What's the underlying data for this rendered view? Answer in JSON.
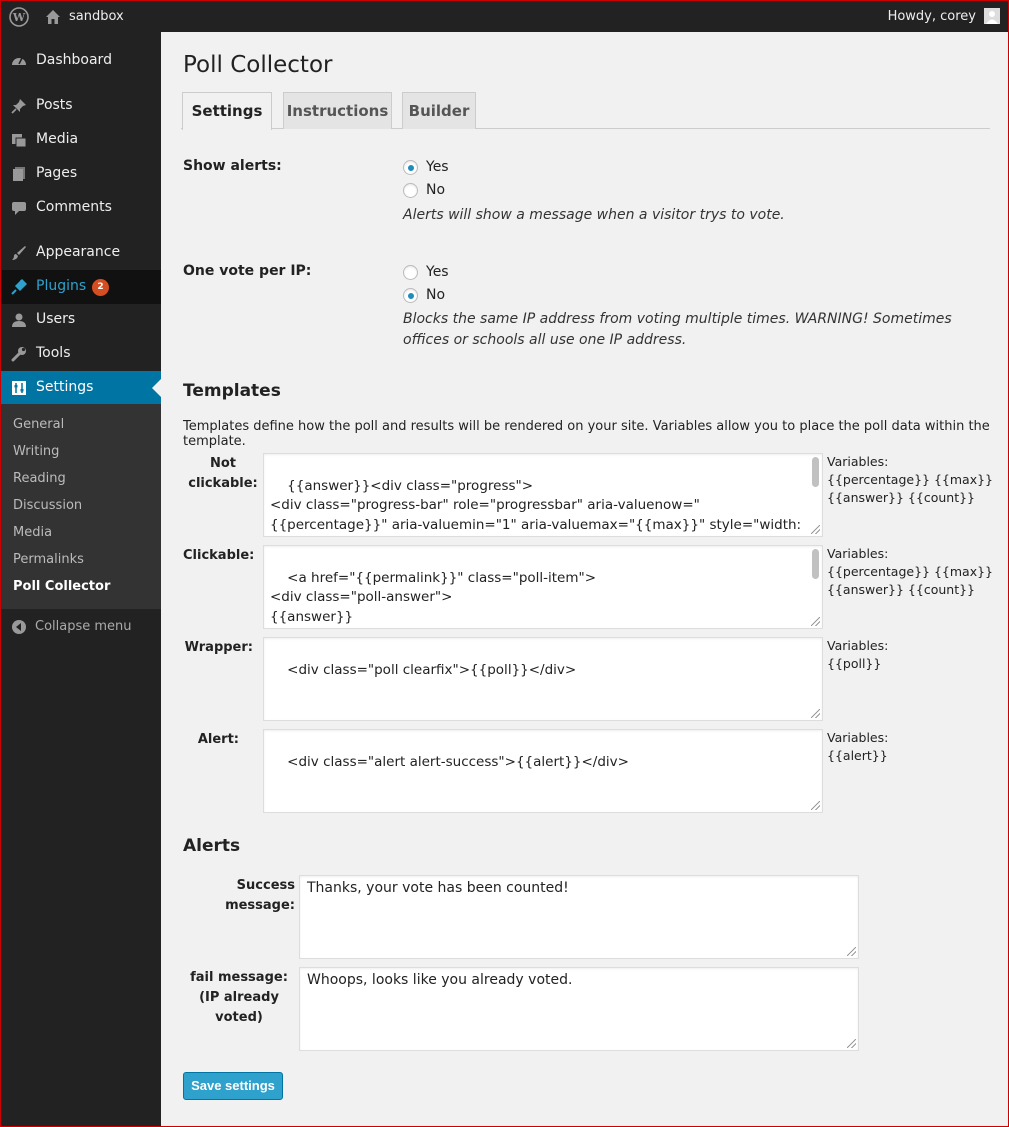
{
  "adminbar": {
    "site_name": "sandbox",
    "howdy": "Howdy, corey",
    "icons": [
      "wordpress-logo-icon",
      "home-icon",
      "avatar"
    ]
  },
  "sidebar": {
    "items": [
      {
        "label": "Dashboard",
        "icon": "dashboard-icon"
      },
      {
        "label": "Posts",
        "icon": "pin-icon"
      },
      {
        "label": "Media",
        "icon": "media-icon"
      },
      {
        "label": "Pages",
        "icon": "pages-icon"
      },
      {
        "label": "Comments",
        "icon": "comment-icon"
      },
      {
        "label": "Appearance",
        "icon": "brush-icon"
      },
      {
        "label": "Plugins",
        "icon": "plug-icon",
        "badge": "2"
      },
      {
        "label": "Users",
        "icon": "user-icon"
      },
      {
        "label": "Tools",
        "icon": "wrench-icon"
      },
      {
        "label": "Settings",
        "icon": "settings-icon"
      }
    ],
    "submenu": [
      "General",
      "Writing",
      "Reading",
      "Discussion",
      "Media",
      "Permalinks",
      "Poll Collector"
    ],
    "collapse": "Collapse menu"
  },
  "main": {
    "title": "Poll Collector",
    "tabs": [
      "Settings",
      "Instructions",
      "Builder"
    ],
    "show_alerts": {
      "label": "Show alerts:",
      "options": [
        "Yes",
        "No"
      ],
      "selected": "Yes",
      "desc": "Alerts will show a message when a visitor trys to vote."
    },
    "one_vote": {
      "label": "One vote per IP:",
      "options": [
        "Yes",
        "No"
      ],
      "selected": "No",
      "desc": "Blocks the same IP address from voting multiple times. WARNING! Sometimes offices or schools all use one IP address."
    },
    "templates": {
      "title": "Templates",
      "intro": "Templates define how the poll and results will be rendered on your site. Variables allow you to place the poll data within the template.",
      "items": [
        {
          "label_line1": "Not",
          "label_line2": "clickable:",
          "value": "{{answer}}<div class=\"progress\">\n<div class=\"progress-bar\" role=\"progressbar\" aria-valuenow=\"{{percentage}}\" aria-valuemin=\"1\" aria-valuemax=\"{{max}}\" style=\"width: {{percentage}}%;\">\n{{count}}",
          "vars_title": "Variables:",
          "vars": "{{percentage}} {{max}} {{answer}} {{count}}"
        },
        {
          "label_line1": "Clickable:",
          "label_line2": "",
          "value": "<a href=\"{{permalink}}\" class=\"poll-item\">\n<div class=\"poll-answer\">\n{{answer}}\n</div>",
          "vars_title": "Variables:",
          "vars": "{{percentage}} {{max}} {{answer}} {{count}}"
        },
        {
          "label_line1": "Wrapper:",
          "label_line2": "",
          "value": "<div class=\"poll clearfix\">{{poll}}</div>",
          "vars_title": "Variables:",
          "vars": "{{poll}}"
        },
        {
          "label_line1": "Alert:",
          "label_line2": "",
          "value": "<div class=\"alert alert-success\">{{alert}}</div>",
          "vars_title": "Variables:",
          "vars": "{{alert}}"
        }
      ]
    },
    "alerts": {
      "title": "Alerts",
      "success_label": "Success message:",
      "success_value": "Thanks, your vote has been counted!",
      "fail_label_line1": "fail message:",
      "fail_label_line2": "(IP already voted)",
      "fail_value": "Whoops, looks like you already voted."
    },
    "save_label": "Save settings"
  },
  "colors": {
    "adminbar": "#222222",
    "sidebar": "#222222",
    "submenu": "#333333",
    "accent": "#0074a2",
    "button": "#2ea2cc",
    "badge": "#d54e21"
  }
}
